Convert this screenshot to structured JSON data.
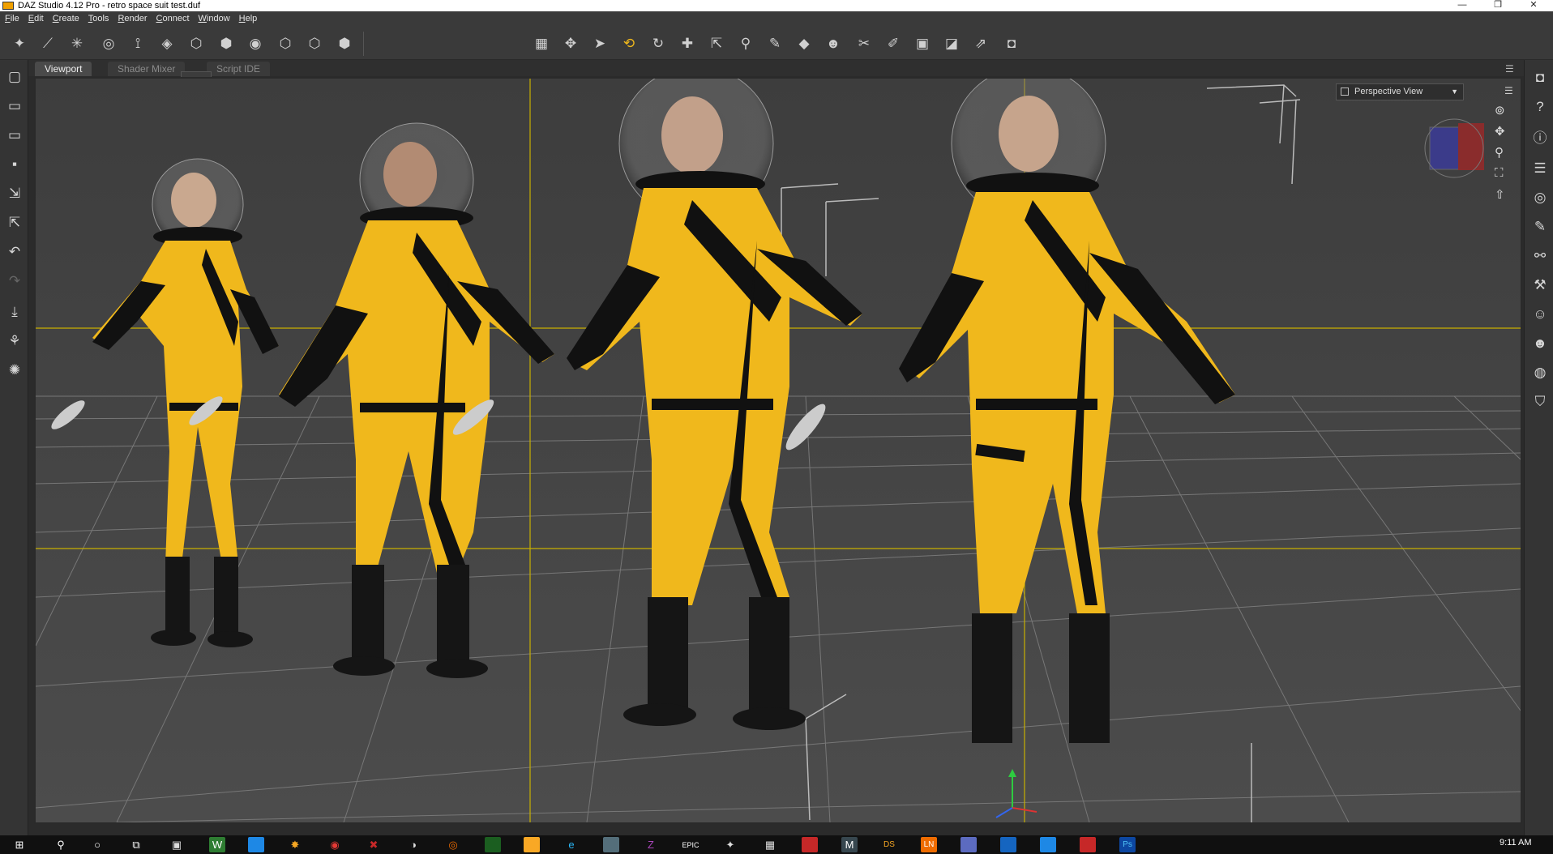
{
  "window": {
    "title": "DAZ Studio 4.12 Pro - retro space suit test.duf",
    "minimize_glyph": "—",
    "maximize_glyph": "❐",
    "close_glyph": "✕"
  },
  "menu": [
    "File",
    "Edit",
    "Create",
    "Tools",
    "Render",
    "Connect",
    "Window",
    "Help"
  ],
  "toolbar": {
    "left_icons": [
      "scene-figure-icon",
      "node-bone-icon",
      "pin-light-icon",
      "spot-render-icon",
      "joint-editor-icon",
      "geometry-editor-icon",
      "primitive-cube-icon",
      "cube-select-icon",
      "distant-light-icon",
      "tube-icon",
      "cube-wire-icon",
      "sphere-icon"
    ],
    "center_icons": [
      "grid-icon",
      "universal-icon",
      "select-arrow-icon",
      "rotate-gold-icon",
      "rotate-icon",
      "translate-icon",
      "scale-icon",
      "joint-icon",
      "surface-pen-icon",
      "node-weight-icon",
      "figure-select-icon",
      "spot-icon",
      "geometry-sculpt-icon",
      "editor-icon",
      "camera-light-icon",
      "pointer-icon",
      "render-camera-icon"
    ]
  },
  "left_sidebar": [
    "new-file-icon",
    "open-folder-icon",
    "merge-folder-icon",
    "save-icon",
    "import-icon",
    "export-icon",
    "undo-icon",
    "redo-icon",
    "drop-icon",
    "walk-icon",
    "run-icon"
  ],
  "right_sidebar": [
    "ds-icon",
    "help-arrow-icon",
    "help-circle-icon",
    "list-icon",
    "content-icon",
    "brush-icon",
    "pose-icon",
    "wrench-icon",
    "figure-head-icon",
    "figure-head-alt-icon",
    "globe-icon",
    "shirt-icon"
  ],
  "tabs": {
    "viewport": "Viewport",
    "shader_mixer": "Shader Mixer",
    "script_ide": "Script IDE"
  },
  "viewport": {
    "view_dropdown": "Perspective View",
    "dropdown_caret": "▼",
    "suit_color": "#f0b81c",
    "guide_color": "#c8b000",
    "floor_color": "#4a4a4a",
    "figures": [
      "figure-female-small",
      "figure-male-older",
      "figure-male",
      "figure-female"
    ]
  },
  "taskbar": {
    "icons": [
      "windows-start-icon",
      "search-icon",
      "cortana-icon",
      "task-view-icon",
      "store-icon",
      "word-icon",
      "email-icon",
      "light-icon",
      "chrome-icon",
      "vmware-icon",
      "paint-icon",
      "blender-icon",
      "game-icon",
      "files-icon",
      "edge-icon",
      "photos-icon",
      "zbrush-icon",
      "epic-icon",
      "sparkle-icon",
      "calculator-icon",
      "red-app-icon",
      "mail-icon",
      "daz-icon",
      "ln-icon",
      "discord-icon",
      "chat-icon",
      "blue-icon",
      "vivaldi-icon",
      "photoshop-icon"
    ],
    "epic_label": "EPIC",
    "ds_label": "DS",
    "ln_label": "LN",
    "ps_label": "Ps",
    "clock": "9:11 AM"
  }
}
